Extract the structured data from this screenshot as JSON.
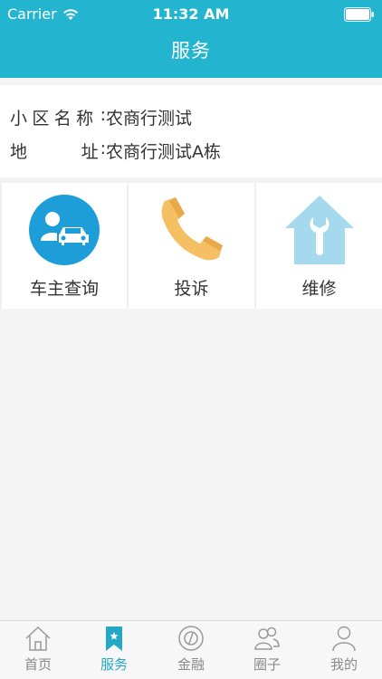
{
  "status_bar": {
    "carrier": "Carrier",
    "time": "11:32 AM"
  },
  "nav": {
    "title": "服务"
  },
  "community": {
    "name_label_parts": [
      "小",
      "区",
      "名",
      "称"
    ],
    "name_value": "农商行测试",
    "address_label_parts": [
      "地",
      "址"
    ],
    "address_value": "农商行测试A栋",
    "colon": ":"
  },
  "services": [
    {
      "label": "车主查询",
      "icon": "car-owner-icon"
    },
    {
      "label": "投诉",
      "icon": "phone-icon"
    },
    {
      "label": "维修",
      "icon": "repair-house-icon"
    }
  ],
  "tabs": [
    {
      "label": "首页",
      "icon": "home-icon",
      "active": false
    },
    {
      "label": "服务",
      "icon": "bookmark-star-icon",
      "active": true
    },
    {
      "label": "金融",
      "icon": "coin-icon",
      "active": false
    },
    {
      "label": "圈子",
      "icon": "group-icon",
      "active": false
    },
    {
      "label": "我的",
      "icon": "person-icon",
      "active": false
    }
  ],
  "colors": {
    "accent": "#23b5cf",
    "tab_active": "#23a8c6",
    "phone": "#f5bf63",
    "repair": "#a5d9ed"
  }
}
